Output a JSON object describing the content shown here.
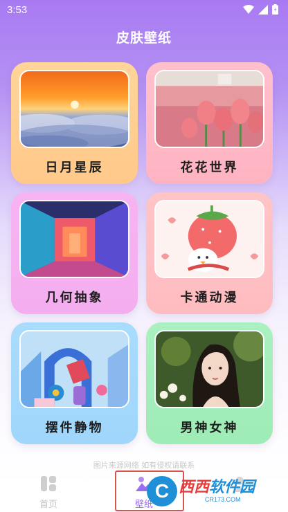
{
  "status_bar": {
    "time": "3:53"
  },
  "app": {
    "title": "皮肤壁纸"
  },
  "categories": [
    {
      "label": "日月星辰",
      "gradient_top": "#ffd59a",
      "gradient_bottom": "#ffc98a"
    },
    {
      "label": "花花世界",
      "gradient_top": "#ffc0cc",
      "gradient_bottom": "#ffb3c2"
    },
    {
      "label": "几何抽象",
      "gradient_top": "#f7b3f2",
      "gradient_bottom": "#f4aef0"
    },
    {
      "label": "卡通动漫",
      "gradient_top": "#ffc4c6",
      "gradient_bottom": "#ffbcc0"
    },
    {
      "label": "摆件静物",
      "gradient_top": "#a9dcfc",
      "gradient_bottom": "#9fd6fb"
    },
    {
      "label": "男神女神",
      "gradient_top": "#aaf0c0",
      "gradient_bottom": "#9eecb6"
    }
  ],
  "footer": {
    "note": "图片来源网络 如有侵权请联系"
  },
  "tabs": {
    "home": "首页",
    "wallpaper": "壁纸"
  },
  "watermark": {
    "circle": "C",
    "text_part1": "西西",
    "text_part2": "软件园",
    "domain": "CR173.COM"
  },
  "colors": {
    "accent": "#9a6ef0",
    "highlight": "#d9534f",
    "tab_inactive": "#c6c6c6"
  }
}
